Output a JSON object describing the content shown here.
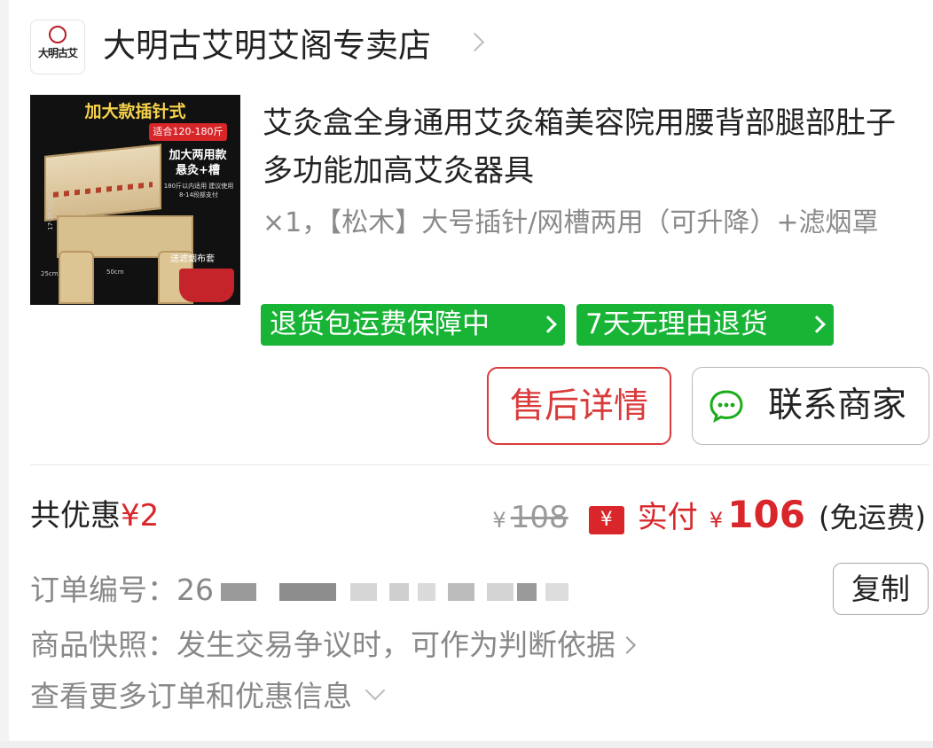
{
  "store": {
    "logo_text": "大明古艾",
    "name": "大明古艾明艾阁专卖店"
  },
  "product": {
    "image": {
      "headline": "加大款插针式",
      "badge": "适合120-180斤",
      "side_text": "加大两用款 悬灸+槽",
      "small_text": "180斤以内适用 建议使用8-14段部支付",
      "check_text": "送滤烟布套",
      "dim_height": "17-39.5cm",
      "dim_width": "50cm",
      "dim_depth": "25cm"
    },
    "title": "艾灸盒全身通用艾灸箱美容院用腰背部腿部肚子多功能加高艾灸器具",
    "spec": "×1，【松木】大号插针/网槽两用（可升降）+滤烟罩",
    "tags": [
      "退货包运费保障中",
      "7天无理由退货"
    ]
  },
  "actions": {
    "after_sale": "售后详情",
    "contact": "联系商家"
  },
  "price": {
    "discount_label": "共优惠",
    "discount_amount": "¥2",
    "original_yen": "¥",
    "original": "108",
    "pay_icon": "¥",
    "pay_label": "实付",
    "pay_yen": "¥",
    "pay_amount": "106",
    "shipping": "(免运费)"
  },
  "order": {
    "number_label": "订单编号：",
    "number_prefix": "26",
    "copy": "复制",
    "snapshot": "商品快照：发生交易争议时，可作为判断依据",
    "more": "查看更多订单和优惠信息"
  },
  "colors": {
    "accent_red": "#d8262a",
    "tag_green": "#18b436"
  },
  "icons": {
    "chat": "chat-bubble-icon",
    "chevron": "chevron-right-icon",
    "chevron_down": "chevron-down-icon"
  }
}
